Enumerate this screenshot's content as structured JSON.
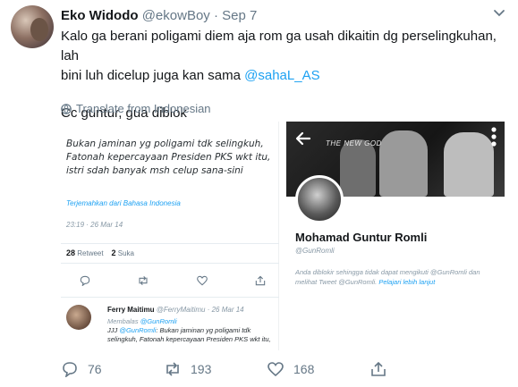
{
  "tweet": {
    "display_name": "Eko Widodo",
    "handle": "@ekowBoy",
    "separator": "·",
    "date": "Sep 7",
    "text_line1": "Kalo ga berani poligami diem aja rom ga usah dikaitin dg perselingkuhan, lah",
    "text_line2_prefix": "bini luh dicelup juga kan sama ",
    "text_mention": "@sahaL_AS",
    "text_line3": "Cc guntur, gua diblok",
    "translate_label": "Translate from Indonesian",
    "counts": {
      "replies": "76",
      "retweets": "193",
      "likes": "168"
    }
  },
  "embedded_image": {
    "left": {
      "quote_lines": [
        "Bukan jaminan yg poligami tdk selingkuh,",
        "Fatonah kepercayaan Presiden PKS wkt itu,",
        "istri sdah banyak msh celup sana-sini"
      ],
      "translate_link": "Terjemahkan dari Bahasa Indonesia",
      "timestamp": "23:19 · 26 Mar 14",
      "retweet_count": "28",
      "retweet_label": "Retweet",
      "like_count": "2",
      "like_label": "Suka",
      "reply": {
        "name": "Ferry Maitimu",
        "handle": "@FerryMaitimu · 26 Mar 14",
        "replying_prefix": "Membalas ",
        "replying_to": "@GunRomli",
        "text_prefix": "JJJ ",
        "text_mention": "@GunRomli",
        "text_rest": ": Bukan jaminan yg poligami tdk selingkuh, Fatonah kepercayaan Presiden PKS wkt itu,"
      }
    },
    "right": {
      "banner_sign": "THE NEW GOD",
      "profile_name": "Mohamad Guntur Romli",
      "profile_handle": "@GunRomli",
      "blocked_text": "Anda diblokir sehingga tidak dapat mengikuti @GunRomli dan melihat Tweet @GunRomli. ",
      "learn_more": "Pelajari lebih lanjut"
    }
  },
  "colors": {
    "link": "#1da1f2",
    "muted": "#657786",
    "text": "#14171a"
  },
  "icons": [
    "caret-down-icon",
    "globe-icon",
    "back-arrow-icon",
    "kebab-menu-icon",
    "reply-icon",
    "retweet-icon",
    "like-icon",
    "share-icon"
  ]
}
